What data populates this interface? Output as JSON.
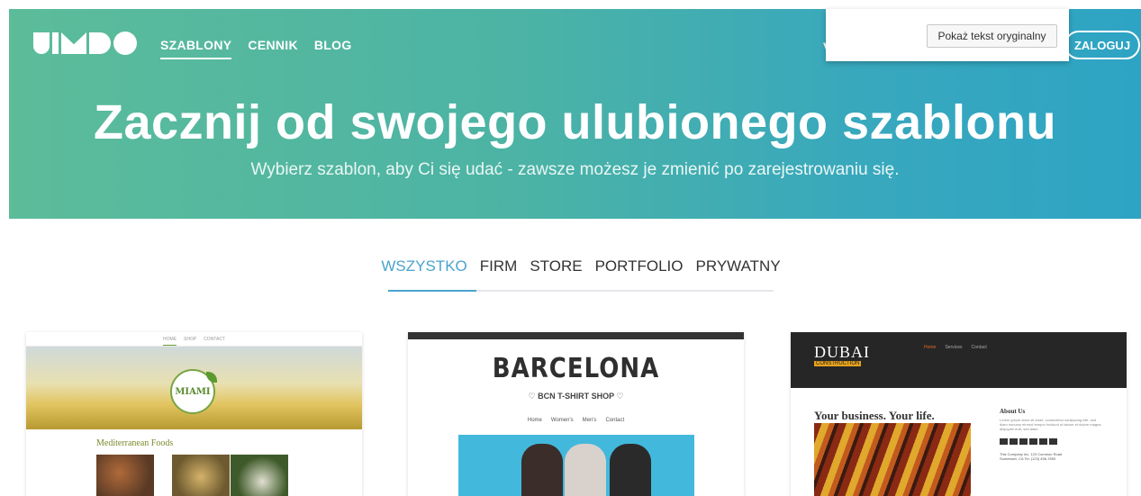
{
  "header": {
    "logo_text": "JIMDO",
    "nav": [
      "SZABLONY",
      "CENNIK",
      "BLOG"
    ],
    "partial_item": "V",
    "login": "ZALOGUJ"
  },
  "translate_popup": {
    "button": "Pokaż tekst oryginalny"
  },
  "hero": {
    "title": "Zacznij od swojego ulubionego szablonu",
    "subtitle": "Wybierz szablon, aby Ci się udać - zawsze możesz je zmienić po zarejestrowaniu się."
  },
  "filters": [
    "WSZYSTKO",
    "FIRM",
    "STORE",
    "PORTFOLIO",
    "PRYWATNY"
  ],
  "templates": {
    "miami": {
      "nav": [
        "HOME",
        "SHOP",
        "CONTACT"
      ],
      "badge": "MIAMI",
      "section_title": "Mediterranean Foods"
    },
    "barcelona": {
      "title": "BARCELONA",
      "shop": "♡ BCN T-SHIRT SHOP ♡",
      "nav": [
        "Home",
        "Women's",
        "Men's",
        "Contact"
      ]
    },
    "dubai": {
      "logo": "DUBAI",
      "sub": "CONSTRUCTION",
      "nav": [
        "Home",
        "Services",
        "Contact"
      ],
      "headline": "Your business. Your life.",
      "about_title": "About Us",
      "about_text": "Lorem ipsum dolor sit amet, consectetur sadipscing elitr, sed diam nonumy eirmod tempor invidunt ut labore et dolore magna aliquyam erat, sed diam.",
      "address": "This Company Inc. 123 Common Road Sometown, CA Tel. (123) 456-7890"
    }
  }
}
